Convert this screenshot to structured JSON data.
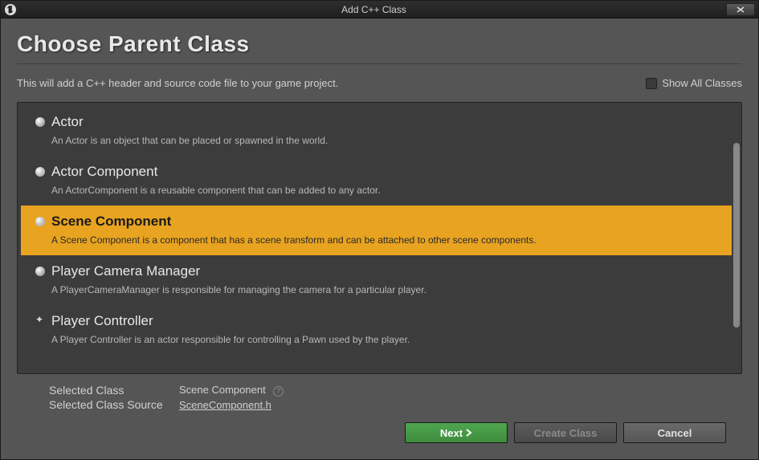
{
  "window": {
    "title": "Add C++ Class"
  },
  "page": {
    "heading": "Choose Parent Class",
    "description": "This will add a C++ header and source code file to your game project.",
    "show_all_label": "Show All Classes"
  },
  "classes": [
    {
      "name": "Actor",
      "desc": "An Actor is an object that can be placed or spawned in the world.",
      "selected": false,
      "icon": "sphere"
    },
    {
      "name": "Actor Component",
      "desc": "An ActorComponent is a reusable component that can be added to any actor.",
      "selected": false,
      "icon": "component"
    },
    {
      "name": "Scene Component",
      "desc": "A Scene Component is a component that has a scene transform and can be attached to other scene components.",
      "selected": true,
      "icon": "component"
    },
    {
      "name": "Player Camera Manager",
      "desc": "A PlayerCameraManager is responsible for managing the camera for a particular player.",
      "selected": false,
      "icon": "sphere"
    },
    {
      "name": "Player Controller",
      "desc": "A Player Controller is an actor responsible for controlling a Pawn used by the player.",
      "selected": false,
      "icon": "controller"
    }
  ],
  "selected_info": {
    "class_label": "Selected Class",
    "class_value": "Scene Component",
    "source_label": "Selected Class Source",
    "source_value": "SceneComponent.h"
  },
  "buttons": {
    "next": "Next",
    "create": "Create Class",
    "cancel": "Cancel"
  }
}
